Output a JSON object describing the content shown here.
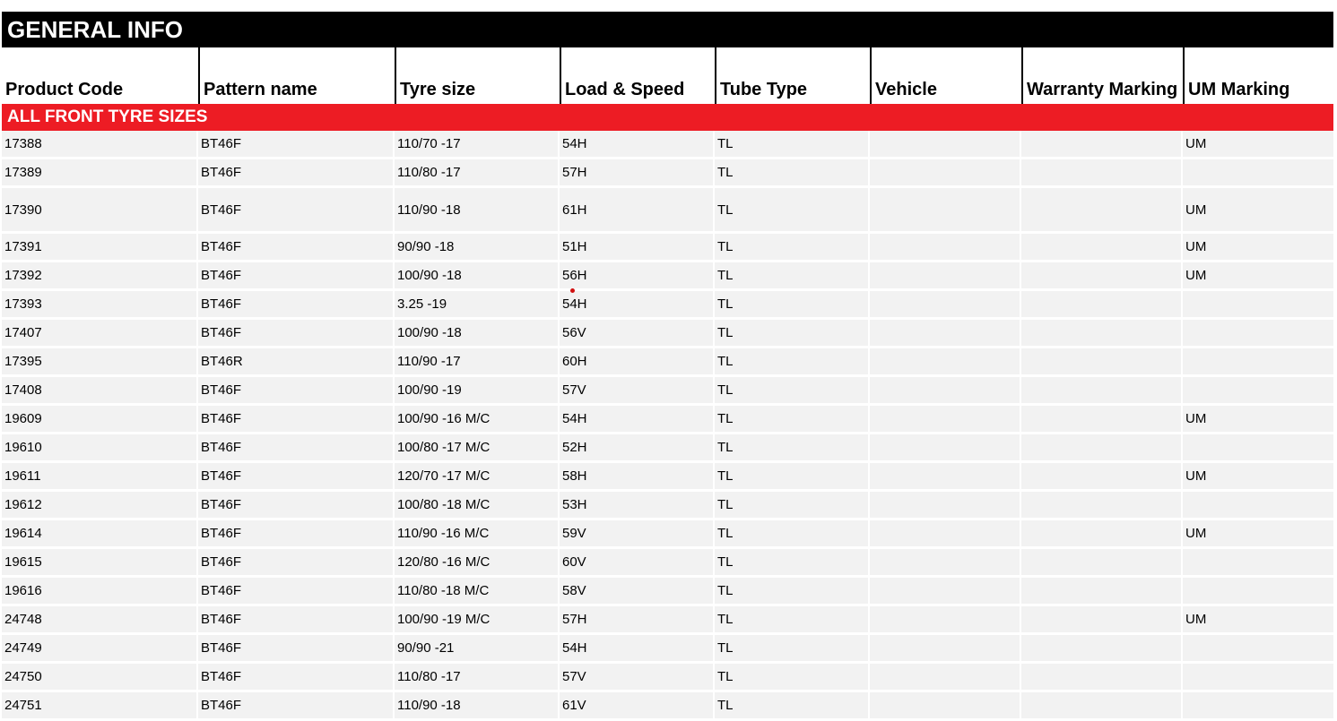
{
  "sheet": {
    "banner": "GENERAL INFO",
    "columns": [
      "Product Code",
      "Pattern name",
      "Tyre size",
      "Load & Speed",
      "Tube Type",
      "Vehicle",
      "Warranty Marking",
      "UM Marking"
    ],
    "section_title": "ALL FRONT TYRE SIZES",
    "rows": [
      [
        "17388",
        "BT46F",
        "110/70 -17",
        "54H",
        "TL",
        "",
        "",
        "UM"
      ],
      [
        "17389",
        "BT46F",
        "110/80 -17",
        "57H",
        "TL",
        "",
        "",
        ""
      ],
      [
        "17390",
        "BT46F",
        "110/90 -18",
        "61H",
        "TL",
        "",
        "",
        "UM"
      ],
      [
        "17391",
        "BT46F",
        "90/90 -18",
        "51H",
        "TL",
        "",
        "",
        "UM"
      ],
      [
        "17392",
        "BT46F",
        "100/90 -18",
        "56H",
        "TL",
        "",
        "",
        "UM"
      ],
      [
        "17393",
        "BT46F",
        "3.25 -19",
        "54H",
        "TL",
        "",
        "",
        ""
      ],
      [
        "17407",
        "BT46F",
        "100/90 -18",
        "56V",
        "TL",
        "",
        "",
        ""
      ],
      [
        "17395",
        "BT46R",
        "110/90 -17",
        "60H",
        "TL",
        "",
        "",
        ""
      ],
      [
        "17408",
        "BT46F",
        "100/90 -19",
        "57V",
        "TL",
        "",
        "",
        ""
      ],
      [
        "19609",
        "BT46F",
        "100/90 -16 M/C",
        "54H",
        "TL",
        "",
        "",
        "UM"
      ],
      [
        "19610",
        "BT46F",
        "100/80 -17 M/C",
        "52H",
        "TL",
        "",
        "",
        ""
      ],
      [
        "19611",
        "BT46F",
        "120/70 -17 M/C",
        "58H",
        "TL",
        "",
        "",
        "UM"
      ],
      [
        "19612",
        "BT46F",
        "100/80 -18 M/C",
        "53H",
        "TL",
        "",
        "",
        ""
      ],
      [
        "19614",
        "BT46F",
        "110/90 -16 M/C",
        "59V",
        "TL",
        "",
        "",
        "UM"
      ],
      [
        "19615",
        "BT46F",
        "120/80 -16 M/C",
        "60V",
        "TL",
        "",
        "",
        ""
      ],
      [
        "19616",
        "BT46F",
        "110/80 -18 M/C",
        "58V",
        "TL",
        "",
        "",
        ""
      ],
      [
        "24748",
        "BT46F",
        "100/90 -19 M/C",
        "57H",
        "TL",
        "",
        "",
        "UM"
      ],
      [
        "24749",
        "BT46F",
        "90/90 -21",
        "54H",
        "TL",
        "",
        "",
        ""
      ],
      [
        "24750",
        "BT46F",
        "110/80 -17",
        "57V",
        "TL",
        "",
        "",
        ""
      ],
      [
        "24751",
        "BT46F",
        "110/90 -18",
        "61V",
        "TL",
        "",
        "",
        ""
      ]
    ]
  },
  "colors": {
    "banner_bg": "#000000",
    "section_bg": "#ed1c24",
    "cell_bg": "#f2f2f2",
    "marker": "#d01010"
  }
}
